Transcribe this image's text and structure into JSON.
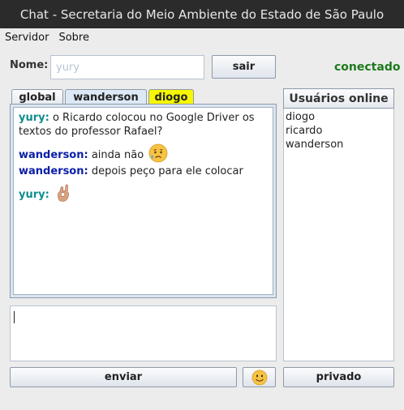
{
  "window": {
    "title": "Chat - Secretaria do Meio Ambiente do Estado de São Paulo"
  },
  "menu": {
    "items": [
      "Servidor",
      "Sobre"
    ]
  },
  "form": {
    "name_label": "Nome:",
    "name_value": "yury",
    "exit_button": "sair"
  },
  "status": {
    "text": "conectado",
    "color": "#1d7a1d"
  },
  "tabs": [
    {
      "label": "global",
      "state": "normal"
    },
    {
      "label": "wanderson",
      "state": "active"
    },
    {
      "label": "diogo",
      "state": "alert"
    }
  ],
  "messages": [
    {
      "user": "yury:",
      "text": "o Ricardo colocou no Google Driver os textos do professor Rafael?",
      "emoji": ""
    },
    {
      "user": "wanderson:",
      "text": "ainda não",
      "emoji": "sad-sweat-face-icon"
    },
    {
      "user": "wanderson:",
      "text": "depois peço para ele colocar",
      "emoji": ""
    },
    {
      "user": "yury:",
      "text": "",
      "emoji": "ok-hand-icon"
    }
  ],
  "users_panel": {
    "title": "Usuários online",
    "users": [
      "diogo",
      "ricardo",
      "wanderson"
    ]
  },
  "buttons": {
    "send": "enviar",
    "emoji_picker": "smiley-icon",
    "private": "privado"
  }
}
